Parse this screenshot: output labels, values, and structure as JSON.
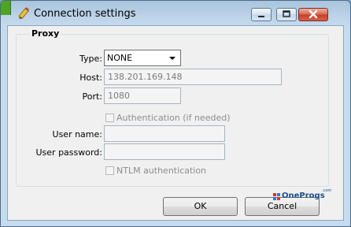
{
  "window": {
    "title": "Connection settings"
  },
  "proxy": {
    "group_label": "Proxy",
    "type_label": "Type:",
    "type_value": "NONE",
    "host_label": "Host:",
    "host_value": "138.201.169.148",
    "port_label": "Port:",
    "port_value": "1080",
    "auth_checkbox_label": "Authentication (if needed)",
    "auth_checked": false,
    "username_label": "User name:",
    "username_value": "",
    "password_label": "User password:",
    "password_value": "",
    "ntlm_checkbox_label": "NTLM authentication",
    "ntlm_checked": false
  },
  "buttons": {
    "ok_label": "OK",
    "cancel_label": "Cancel"
  },
  "watermark": {
    "text": "OneProgs",
    "suffix": ".com"
  },
  "icons": {
    "title_icon": "key-pencil-icon",
    "minimize": "minimize-icon",
    "maximize": "maximize-icon",
    "close": "close-icon",
    "dropdown": "chevron-down-icon"
  },
  "colors": {
    "title_bar": "#bcd3e8",
    "close_button": "#c43e27",
    "dialog_bg": "#f0f0f0",
    "disabled_text": "#8d8d8d"
  }
}
